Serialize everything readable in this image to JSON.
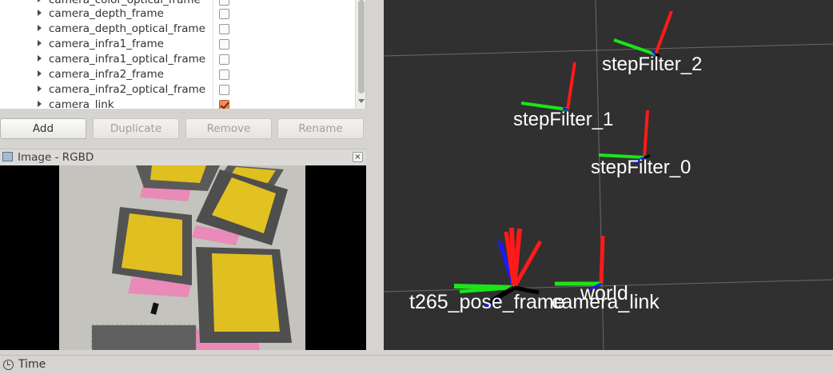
{
  "tree": {
    "rows": [
      {
        "label": "camera_color_optical_frame",
        "checked": false
      },
      {
        "label": "camera_depth_frame",
        "checked": false
      },
      {
        "label": "camera_depth_optical_frame",
        "checked": false
      },
      {
        "label": "camera_infra1_frame",
        "checked": false
      },
      {
        "label": "camera_infra1_optical_frame",
        "checked": false
      },
      {
        "label": "camera_infra2_frame",
        "checked": false
      },
      {
        "label": "camera_infra2_optical_frame",
        "checked": false
      },
      {
        "label": "camera_link",
        "checked": true
      }
    ]
  },
  "buttons": {
    "add": "Add",
    "duplicate": "Duplicate",
    "remove": "Remove",
    "rename": "Rename"
  },
  "image_panel": {
    "title": "Image - RGBD"
  },
  "viewport": {
    "frames": [
      {
        "label": "stepFilter_2"
      },
      {
        "label": "stepFilter_1"
      },
      {
        "label": "stepFilter_0"
      },
      {
        "label": "t265_pose_frame"
      },
      {
        "label": "world"
      },
      {
        "label": "camera_link"
      }
    ]
  },
  "statusbar": {
    "label": "Time"
  },
  "colors": {
    "x_axis": "#ff1a1a",
    "y_axis": "#19e619",
    "z_axis": "#1a1aff",
    "viewport_bg": "#303030",
    "checkbox_checked": "#f08a5d"
  }
}
